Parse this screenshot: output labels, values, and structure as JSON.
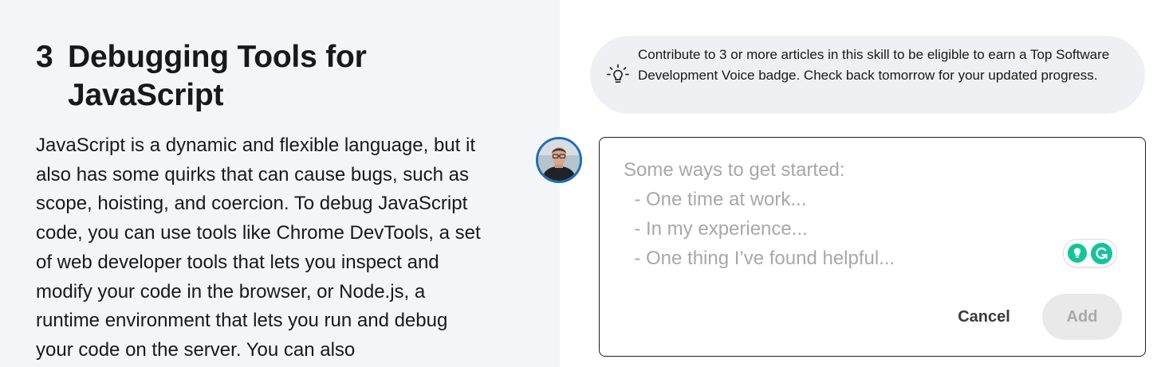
{
  "article": {
    "section_number": "3",
    "section_title": "Debugging Tools for JavaScript",
    "body": "JavaScript is a dynamic and flexible language, but it also has some quirks that can cause bugs, such as scope, hoisting, and coercion. To debug JavaScript code, you can use tools like Chrome DevTools, a set of web developer tools that lets you inspect and modify your code in the browser, or Node.js, a runtime environment that lets you run and debug your code on the server. You can also"
  },
  "tip": {
    "icon": "lightbulb-icon",
    "text": "Contribute to 3 or more articles in this skill to be eligible to earn a Top Software Development Voice badge. Check back tomorrow for your updated progress."
  },
  "editor": {
    "avatar": "user-avatar",
    "placeholder": "Some ways to get started:\n  - One time at work...\n  - In my experience...\n  - One thing I’ve found helpful...",
    "grammarly_icons": [
      "grammarly-suggestion-icon",
      "grammarly-logo-icon"
    ],
    "cancel_label": "Cancel",
    "add_label": "Add"
  },
  "colors": {
    "left_background": "#f4f5f7",
    "tip_background": "#eef0f3",
    "avatar_ring": "#1d6fb3",
    "grammarly_green": "#15c39a",
    "placeholder_text": "#a8a8a8"
  }
}
